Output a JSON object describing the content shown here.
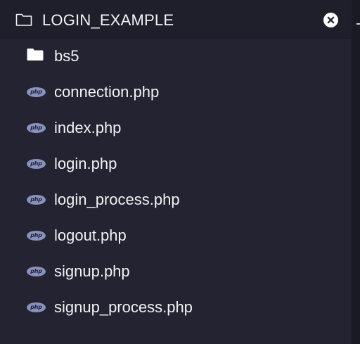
{
  "explorer": {
    "title": "LOGIN_EXAMPLE",
    "header_icon": "folder-outline-icon",
    "close_icon": "close-circle-icon",
    "items": [
      {
        "label": "bs5",
        "icon": "folder-icon"
      },
      {
        "label": "connection.php",
        "icon": "php-file-icon",
        "badge": "php"
      },
      {
        "label": "index.php",
        "icon": "php-file-icon",
        "badge": "php"
      },
      {
        "label": "login.php",
        "icon": "php-file-icon",
        "badge": "php"
      },
      {
        "label": "login_process.php",
        "icon": "php-file-icon",
        "badge": "php"
      },
      {
        "label": "logout.php",
        "icon": "php-file-icon",
        "badge": "php"
      },
      {
        "label": "signup.php",
        "icon": "php-file-icon",
        "badge": "php"
      },
      {
        "label": "signup_process.php",
        "icon": "php-file-icon",
        "badge": "php"
      }
    ]
  },
  "colors": {
    "panel_background": "#232331",
    "header_background": "#1f1f2b",
    "text": "#f2f2f5",
    "php_badge": "#8892bf"
  }
}
